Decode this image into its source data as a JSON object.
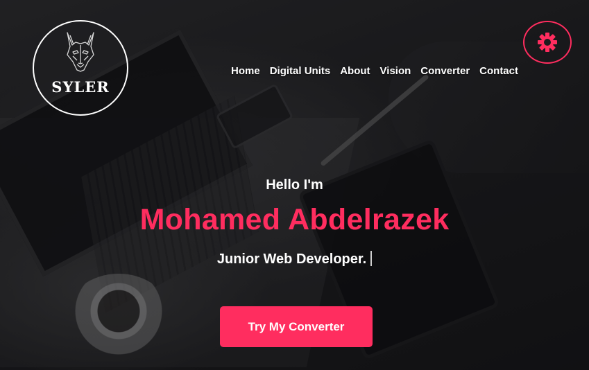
{
  "brand": {
    "logo_text": "SYLER",
    "logo_icon": "wolf-icon"
  },
  "nav": {
    "items": [
      {
        "label": "Home"
      },
      {
        "label": "Digital Units"
      },
      {
        "label": "About"
      },
      {
        "label": "Vision"
      },
      {
        "label": "Converter"
      },
      {
        "label": "Contact"
      }
    ]
  },
  "settings": {
    "icon": "gear-icon"
  },
  "hero": {
    "greeting": "Hello I'm",
    "name": "Mohamed Abdelrazek",
    "role": "Junior Web Developer.",
    "cta_label": "Try My Converter"
  },
  "colors": {
    "accent": "#ff2d5f",
    "text": "#ffffff"
  }
}
